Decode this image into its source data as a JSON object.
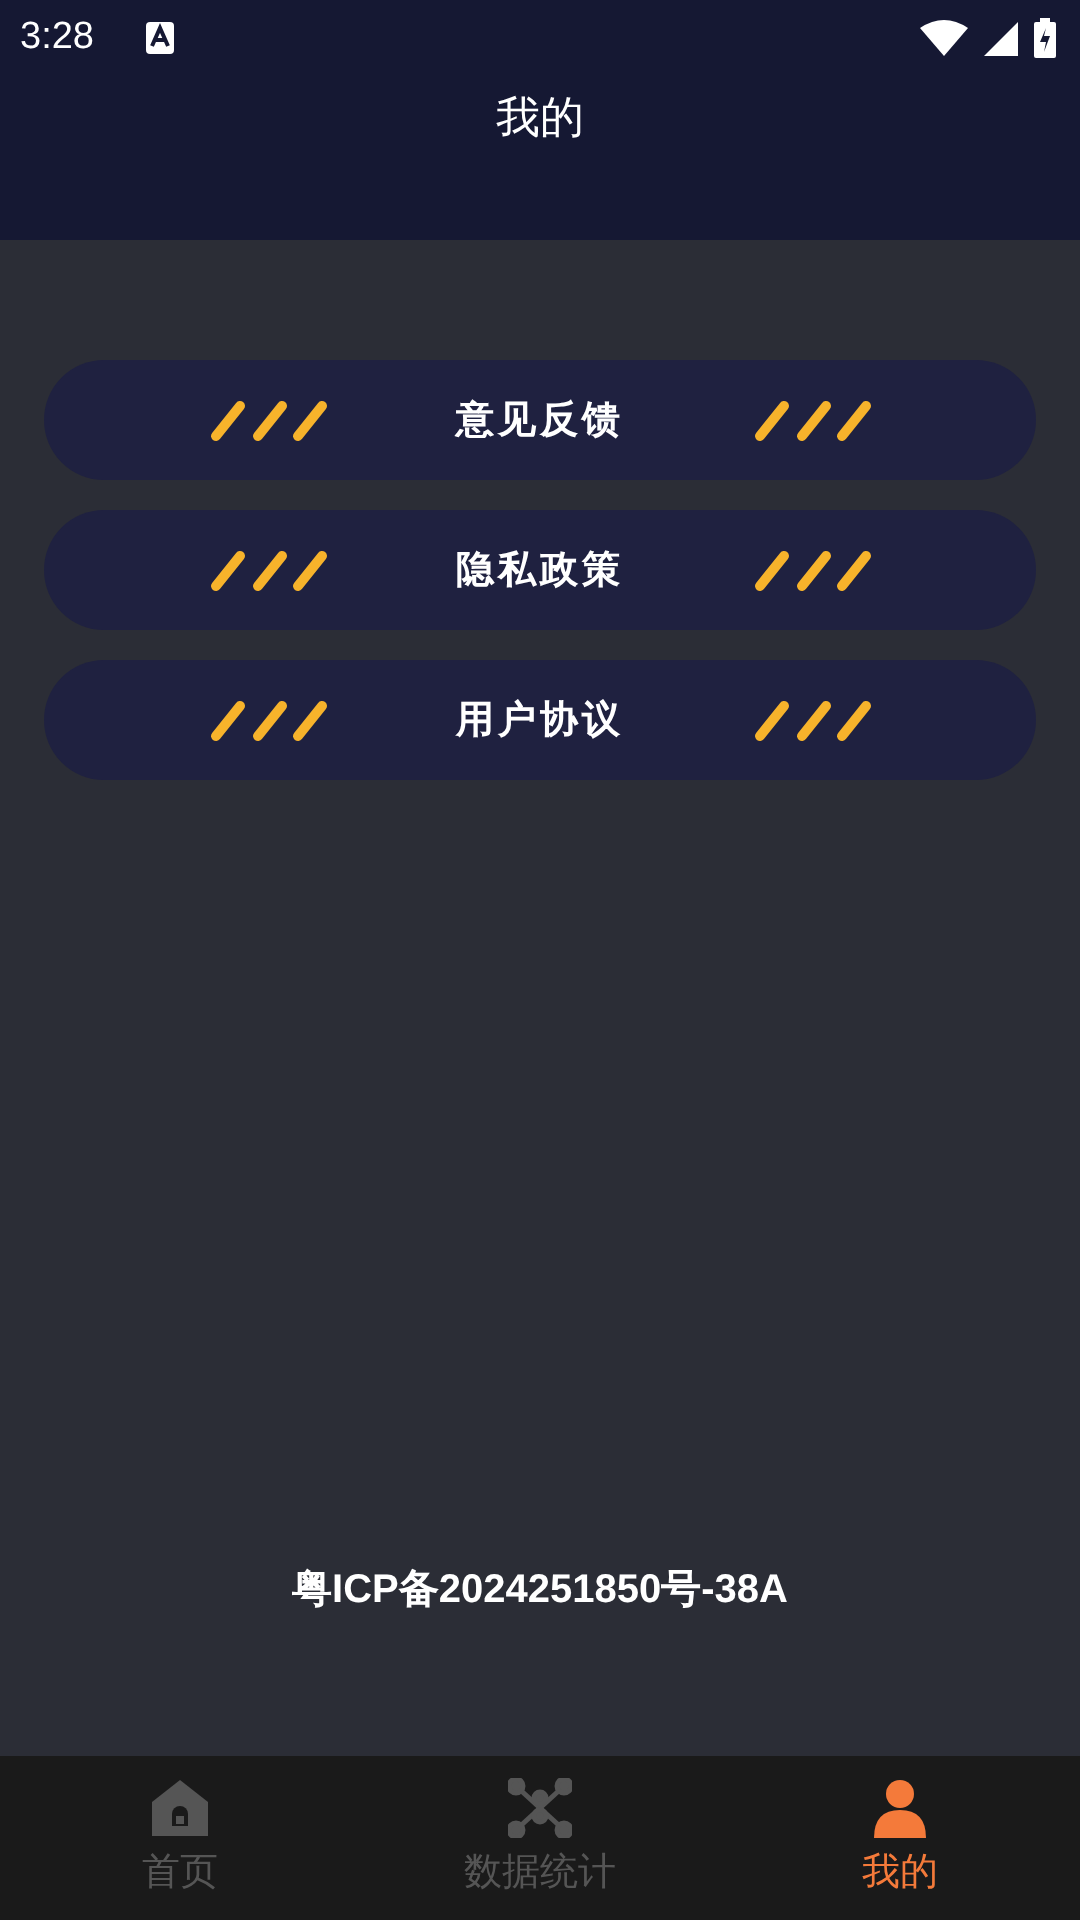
{
  "status_bar": {
    "time": "3:28"
  },
  "header": {
    "title": "我的"
  },
  "menu": [
    {
      "label": "意见反馈"
    },
    {
      "label": "隐私政策"
    },
    {
      "label": "用户协议"
    }
  ],
  "footer": {
    "icp": "粤ICP备2024251850号-38A"
  },
  "tab_bar": [
    {
      "kind": "home",
      "label": "首页",
      "selected": false
    },
    {
      "kind": "stats",
      "label": "数据统计",
      "selected": false
    },
    {
      "kind": "person",
      "label": "我的",
      "selected": true
    }
  ]
}
